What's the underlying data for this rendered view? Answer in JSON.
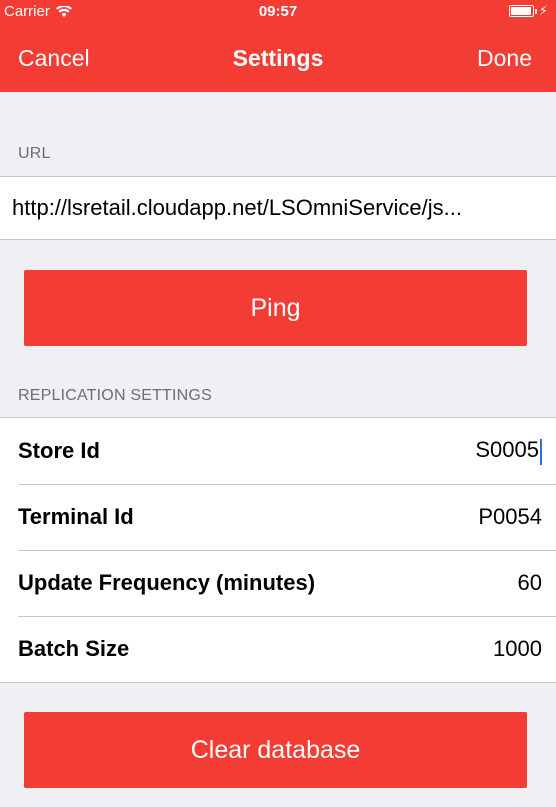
{
  "status_bar": {
    "carrier": "Carrier",
    "time": "09:57",
    "wifi_icon": "wifi-icon",
    "battery_icon": "battery-icon",
    "charging_icon": "charging-bolt-icon"
  },
  "nav": {
    "cancel_label": "Cancel",
    "title": "Settings",
    "done_label": "Done"
  },
  "url_section": {
    "header": "URL",
    "value": "http://lsretail.cloudapp.net/LSOmniService/js..."
  },
  "ping_button": {
    "label": "Ping"
  },
  "replication": {
    "header": "REPLICATION SETTINGS",
    "rows": [
      {
        "label": "Store Id",
        "value": "S0005"
      },
      {
        "label": "Terminal Id",
        "value": "P0054"
      },
      {
        "label": "Update Frequency (minutes)",
        "value": "60"
      },
      {
        "label": "Batch Size",
        "value": "1000"
      }
    ]
  },
  "clear_button": {
    "label": "Clear database"
  },
  "colors": {
    "accent": "#f33c33",
    "background": "#efeff4",
    "caret": "#2f6fe4"
  }
}
